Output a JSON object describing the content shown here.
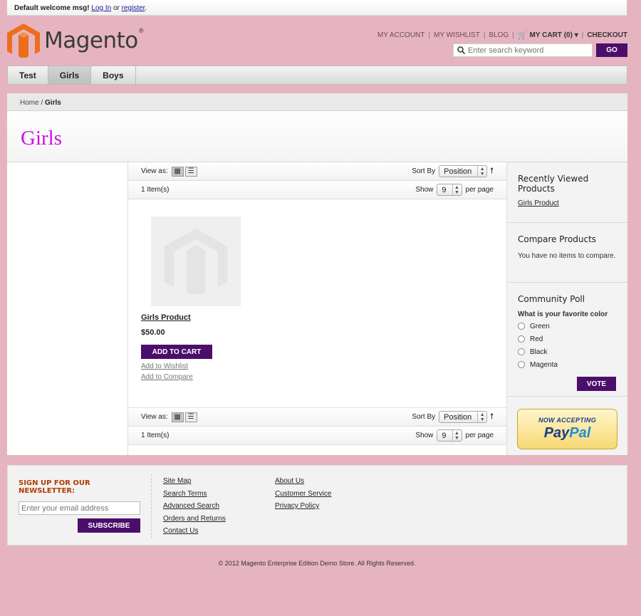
{
  "topbar": {
    "welcome": "Default welcome msg!",
    "login": "Log In",
    "or": "or",
    "register": "register",
    "end": "."
  },
  "logo": {
    "text": "Magento",
    "reg": "®"
  },
  "toplinks": {
    "account": "My Account",
    "wishlist": "My Wishlist",
    "blog": "Blog",
    "cart": "MY CART (0) ▾",
    "checkout": "Checkout",
    "separator": "|"
  },
  "search": {
    "placeholder": "Enter search keyword",
    "button": "GO"
  },
  "nav": {
    "items": [
      "Test",
      "Girls",
      "Boys"
    ],
    "active": "Girls"
  },
  "breadcrumb": {
    "home": "Home",
    "sep": " / ",
    "current": "Girls"
  },
  "page": {
    "title": "Girls"
  },
  "toolbar": {
    "view_as": "View as:",
    "sort_by": "Sort By",
    "sort_value": "Position",
    "items": "1 Item(s)",
    "show": "Show",
    "show_value": "9",
    "per_page": "per page"
  },
  "product": {
    "name": "Girls Product",
    "price": "$50.00",
    "add_to_cart": "ADD TO CART",
    "add_to_wishlist": "Add to Wishlist",
    "add_to_compare": "Add to Compare"
  },
  "sidebar": {
    "recently_viewed": {
      "title": "Recently Viewed Products",
      "item": "Girls Product"
    },
    "compare": {
      "title": "Compare Products",
      "text": "You have no items to compare."
    },
    "poll": {
      "title": "Community Poll",
      "question": "What is your favorite color",
      "options": [
        "Green",
        "Red",
        "Black",
        "Magenta"
      ],
      "vote": "VOTE"
    },
    "paypal": {
      "top": "NOW ACCEPTING",
      "pay": "Pay",
      "pal": "Pal"
    }
  },
  "footer": {
    "newsletter_title": "Sign up for our newsletter:",
    "newsletter_placeholder": "Enter your email address",
    "subscribe": "SUBSCRIBE",
    "col1": [
      "Site Map",
      "Search Terms",
      "Advanced Search",
      "Orders and Returns",
      "Contact Us"
    ],
    "col2": [
      "About Us",
      "Customer Service",
      "Privacy Policy"
    ]
  },
  "copyright": "© 2012 Magento Enterprise Edition Demo Store. All Rights Reserved.",
  "colors": {
    "background": "#e6b4c0",
    "button": "#4b0e6b",
    "title": "#cc11dd",
    "newsletter": "#b33b00"
  }
}
